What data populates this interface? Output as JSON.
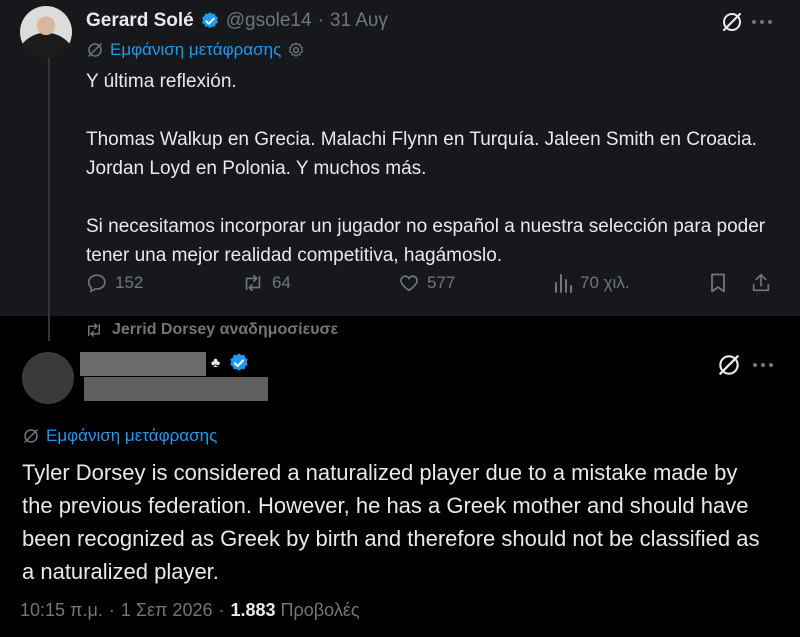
{
  "tweet1": {
    "author_name": "Gerard Solé",
    "handle": "@gsole14",
    "separator": "·",
    "date": "31 Αυγ",
    "translate_label": "Εμφάνιση μετάφρασης",
    "text": "Y última reflexión.\n\nThomas Walkup en Grecia. Malachi Flynn en Turquía. Jaleen Smith en Croacia. Jordan Loyd en Polonia. Y muchos más.\n\nSi necesitamos incorporar un jugador no español a nuestra selección para poder tener una mejor realidad competitiva, hagámoslo.",
    "replies": "152",
    "reposts": "64",
    "likes": "577",
    "views": "70 χιλ."
  },
  "retweet_notice": "Jerrid Dorsey αναδημοσίευσε",
  "tweet2": {
    "name_suffix": "♣",
    "translate_label": "Εμφάνιση μετάφρασης",
    "text": "Tyler Dorsey is considered a naturalized player due to a mistake made by the previous federation. However, he has a Greek mother and should have been recognized as Greek by birth and therefore should not be classified as a naturalized player.",
    "time": "10:15 π.μ.",
    "dot1": "·",
    "date": "1 Σεπ 2026",
    "dot2": "·",
    "views_count": "1.883",
    "views_label": "Προβολές"
  },
  "colors": {
    "accent": "#1d9bf0",
    "muted": "#71767b",
    "text": "#e7e9ea",
    "bg": "#000000",
    "highlight_bg": "#16181c"
  }
}
